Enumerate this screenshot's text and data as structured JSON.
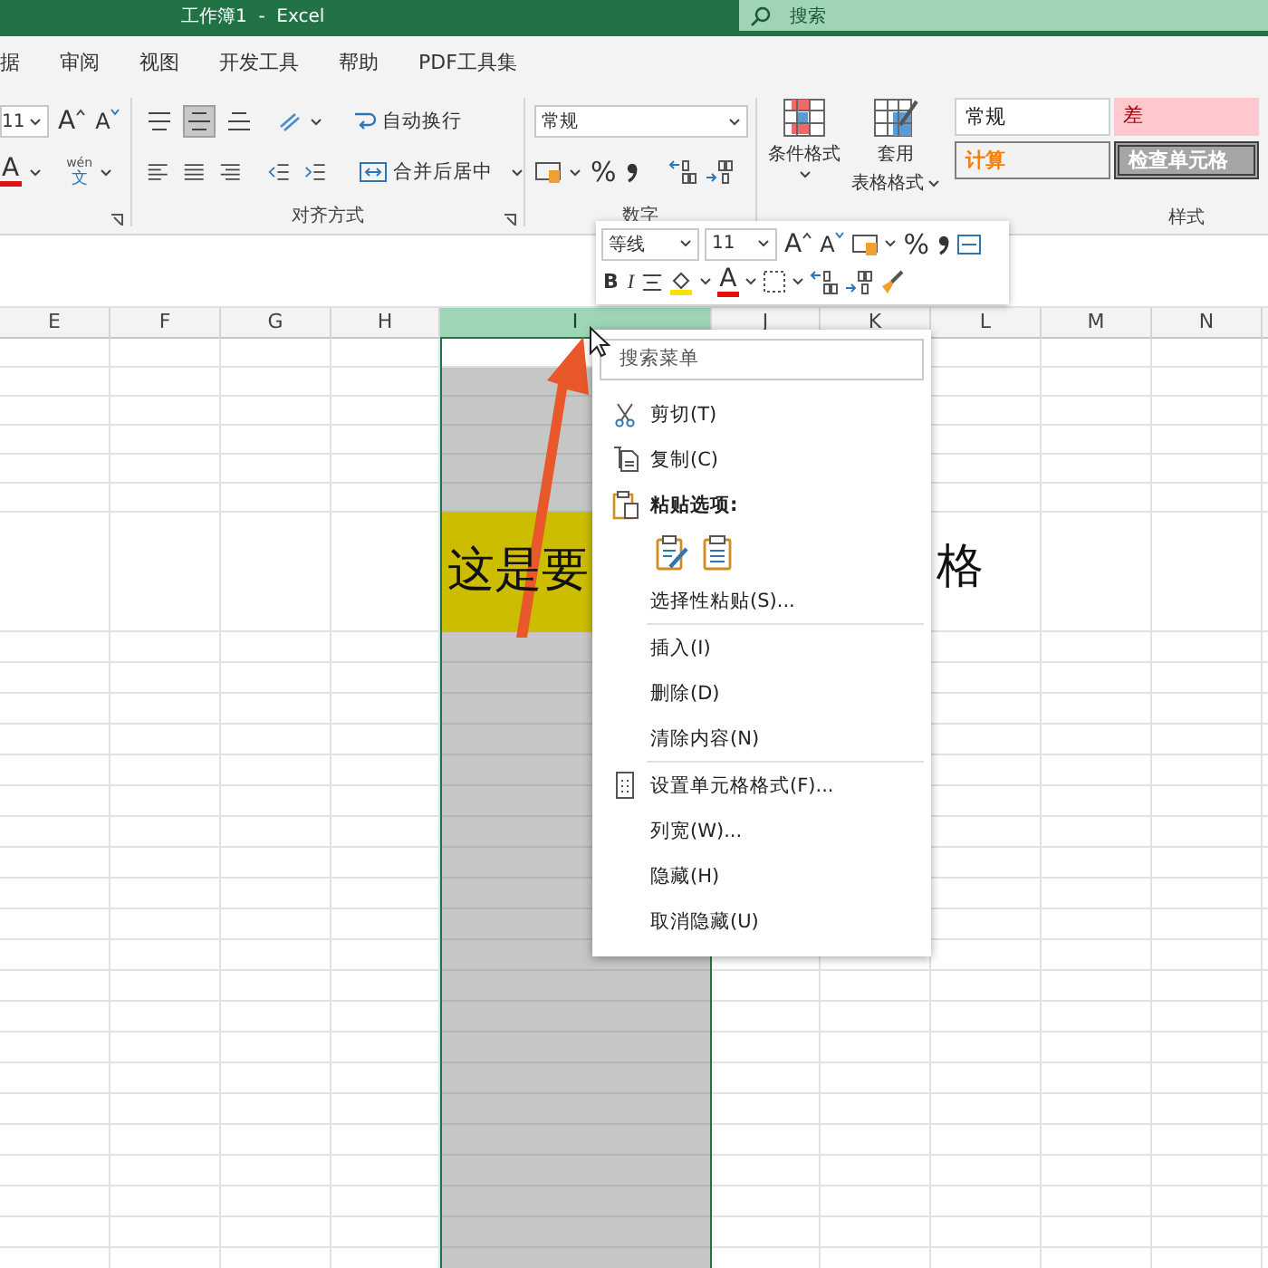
{
  "window": {
    "title": "工作簿1  -  Excel",
    "search_placeholder": "搜索"
  },
  "ribbon_tabs": [
    {
      "label": "据"
    },
    {
      "label": "审阅"
    },
    {
      "label": "视图"
    },
    {
      "label": "开发工具"
    },
    {
      "label": "帮助"
    },
    {
      "label": "PDF工具集"
    }
  ],
  "font_group": {
    "size": "11",
    "grow": "A",
    "shrink": "A",
    "font_color": "A",
    "phonetic": [
      "wén",
      "文"
    ]
  },
  "alignment_group": {
    "top_row": [
      {
        "selected": false
      },
      {
        "selected": true
      },
      {
        "selected": false
      }
    ],
    "wrap_text": "自动换行",
    "merge_center": "合并后居中",
    "label": "对齐方式"
  },
  "number_group": {
    "format": "常规",
    "percent": "%",
    "label": "数字"
  },
  "styles_group": {
    "conditional_format": "条件格式",
    "table_format": [
      "套用",
      "表格格式"
    ],
    "cells": [
      {
        "label": "常规",
        "kind": "normal"
      },
      {
        "label": "差",
        "kind": "bad"
      },
      {
        "label": "计算",
        "kind": "calculation"
      },
      {
        "label": "检查单元格",
        "kind": "check"
      }
    ],
    "label": "样式"
  },
  "mini_toolbar": {
    "font": "等线",
    "size": "11",
    "grow": "A",
    "shrink": "A",
    "percent": "%",
    "bold": "B",
    "italic": "I",
    "font_color": "A"
  },
  "sheet": {
    "columns": [
      {
        "label": "E",
        "selected": false
      },
      {
        "label": "F",
        "selected": false
      },
      {
        "label": "G",
        "selected": false
      },
      {
        "label": "H",
        "selected": false
      },
      {
        "label": "I",
        "selected": true
      },
      {
        "label": "J",
        "selected": false
      },
      {
        "label": "K",
        "selected": false
      },
      {
        "label": "L",
        "selected": false
      },
      {
        "label": "M",
        "selected": false
      },
      {
        "label": "N",
        "selected": false
      }
    ],
    "cell_text_left": "这是要",
    "cell_text_right": "格"
  },
  "context_menu": {
    "search_placeholder": "搜索菜单",
    "items": [
      {
        "kind": "cut",
        "label": "剪切(T)"
      },
      {
        "kind": "copy",
        "label": "复制(C)"
      },
      {
        "kind": "paste-heading",
        "label": "粘贴选项:"
      },
      {
        "kind": "paste-icons"
      },
      {
        "kind": "plain",
        "label": "选择性粘贴(S)..."
      },
      {
        "kind": "separator"
      },
      {
        "kind": "plain",
        "label": "插入(I)"
      },
      {
        "kind": "plain",
        "label": "删除(D)"
      },
      {
        "kind": "plain",
        "label": "清除内容(N)"
      },
      {
        "kind": "separator"
      },
      {
        "kind": "format",
        "label": "设置单元格格式(F)..."
      },
      {
        "kind": "plain",
        "label": "列宽(W)..."
      },
      {
        "kind": "plain",
        "label": "隐藏(H)"
      },
      {
        "kind": "plain",
        "label": "取消隐藏(U)"
      }
    ]
  }
}
